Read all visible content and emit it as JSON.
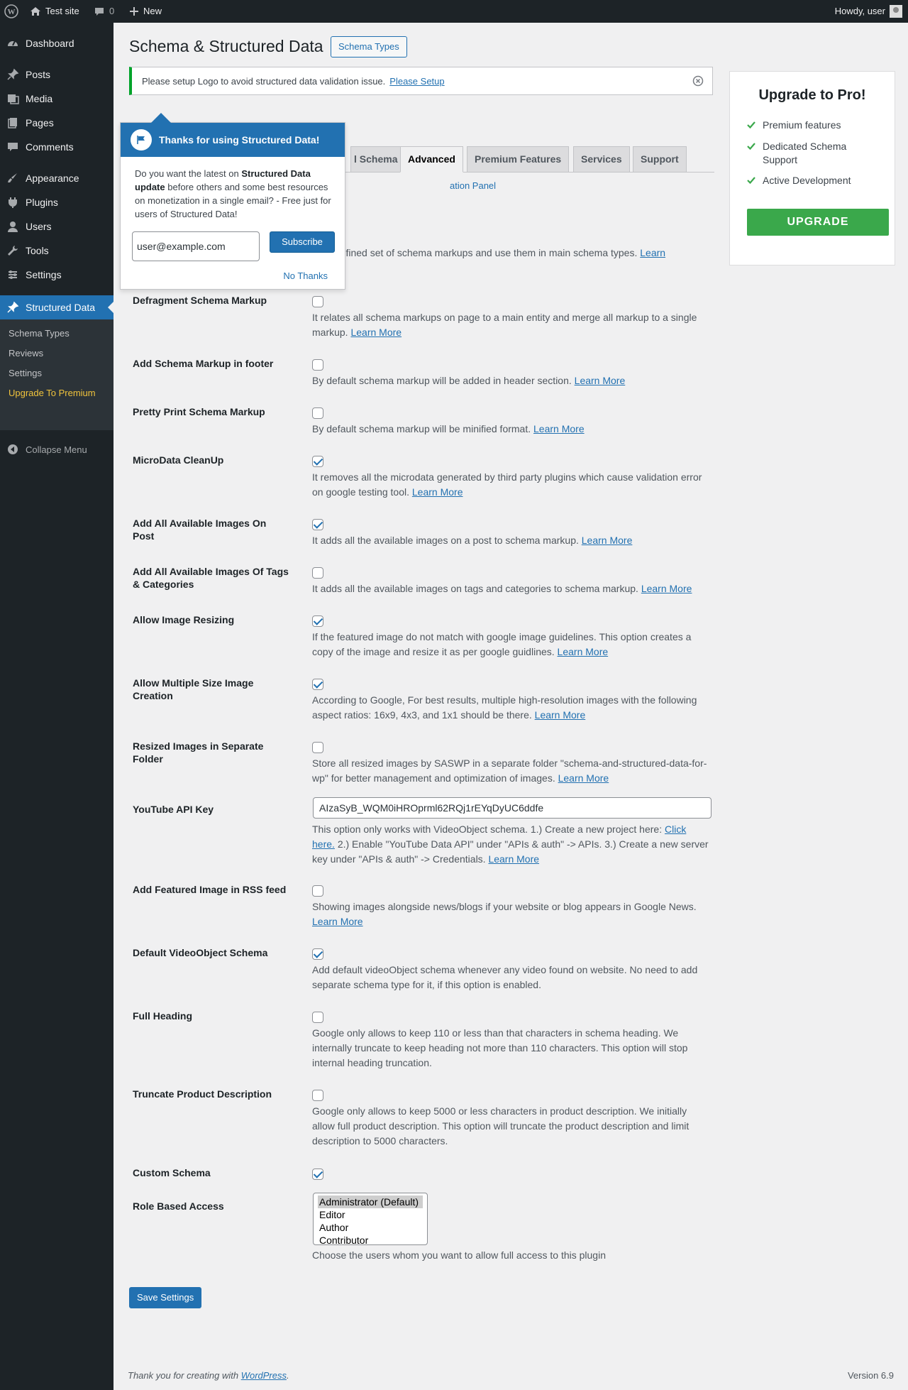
{
  "adminbar": {
    "site": "Test site",
    "comments_count": "0",
    "new": "New",
    "howdy": "Howdy, user"
  },
  "sidebar": {
    "items": [
      {
        "label": "Dashboard",
        "icon": "dashboard-icon"
      },
      {
        "label": "Posts",
        "icon": "pin-icon"
      },
      {
        "label": "Media",
        "icon": "media-icon"
      },
      {
        "label": "Pages",
        "icon": "pages-icon"
      },
      {
        "label": "Comments",
        "icon": "comment-icon"
      },
      {
        "label": "Appearance",
        "icon": "brush-icon"
      },
      {
        "label": "Plugins",
        "icon": "plugin-icon"
      },
      {
        "label": "Users",
        "icon": "user-icon"
      },
      {
        "label": "Tools",
        "icon": "wrench-icon"
      },
      {
        "label": "Settings",
        "icon": "settings-icon"
      },
      {
        "label": "Structured Data",
        "icon": "pin-icon"
      }
    ],
    "submenu": [
      "Schema Types",
      "Reviews",
      "Settings",
      "Upgrade To Premium"
    ],
    "collapse": "Collapse Menu"
  },
  "page": {
    "title": "Schema & Structured Data",
    "title_button": "Schema Types"
  },
  "notice": {
    "text": "Please setup Logo to avoid structured data validation issue.",
    "link": "Please Setup"
  },
  "tabs": [
    "l Schema",
    "Advanced",
    "Premium Features",
    "Services",
    "Support"
  ],
  "sub_link": "ation Panel",
  "partial_row_text": "a predefined set of schema markups and use them in main schema types.",
  "learn": "Learn",
  "learn_more": "Learn More",
  "rows": [
    {
      "label": "Defragment Schema Markup",
      "checked": false,
      "desc": "It relates all schema markups on page to a main entity and merge all markup to a single markup."
    },
    {
      "label": "Add Schema Markup in footer",
      "checked": false,
      "desc": "By default schema markup will be added in header section."
    },
    {
      "label": "Pretty Print Schema Markup",
      "checked": false,
      "desc": "By default schema markup will be minified format."
    },
    {
      "label": "MicroData CleanUp",
      "checked": true,
      "desc": "It removes all the microdata generated by third party plugins which cause validation error on google testing tool."
    },
    {
      "label": "Add All Available Images On Post",
      "checked": true,
      "desc": "It adds all the available images on a post to schema markup."
    },
    {
      "label": "Add All Available Images Of Tags & Categories",
      "checked": false,
      "desc": "It adds all the available images on tags and categories to schema markup."
    },
    {
      "label": "Allow Image Resizing",
      "checked": true,
      "desc": "If the featured image do not match with google image guidelines. This option creates a copy of the image and resize it as per google guidlines."
    },
    {
      "label": "Allow Multiple Size Image Creation",
      "checked": true,
      "desc": "According to Google, For best results, multiple high-resolution images with the following aspect ratios: 16x9, 4x3, and 1x1 should be there."
    },
    {
      "label": "Resized Images in Separate Folder",
      "checked": false,
      "desc": "Store all resized images by SASWP in a separate folder \"schema-and-structured-data-for-wp\" for better management and optimization of images."
    },
    {
      "label": "YouTube API Key",
      "value": "AIzaSyB_WQM0iHROprml62RQj1rEYqDyUC6ddfe",
      "desc_before": "This option only works with VideoObject schema. 1.) Create a new project here:",
      "click_here": "Click here.",
      "desc_after": "2.) Enable \"YouTube Data API\" under \"APIs & auth\" -> APIs. 3.) Create a new server key under \"APIs & auth\" -> Credentials."
    },
    {
      "label": "Add Featured Image in RSS feed",
      "checked": false,
      "desc": "Showing images alongside news/blogs if your website or blog appears in Google News."
    },
    {
      "label": "Default VideoObject Schema",
      "checked": true,
      "desc": "Add default videoObject schema whenever any video found on website. No need to add separate schema type for it, if this option is enabled."
    },
    {
      "label": "Full Heading",
      "checked": false,
      "desc": "Google only allows to keep 110 or less than that characters in schema heading. We internally truncate to keep heading not more than 110 characters. This option will stop internal heading truncation."
    },
    {
      "label": "Truncate Product Description",
      "checked": false,
      "desc": "Google only allows to keep 5000 or less characters in product description. We initially allow full product description. This option will truncate the product description and limit description to 5000 characters."
    },
    {
      "label": "Custom Schema",
      "checked": true
    },
    {
      "label": "Role Based Access",
      "options": [
        "Administrator (Default)",
        "Editor",
        "Author",
        "Contributor"
      ],
      "selected": "Administrator (Default)",
      "desc": "Choose the users whom you want to allow full access to this plugin"
    }
  ],
  "save": "Save Settings",
  "footer": {
    "thanks": "Thank you for creating with",
    "wp": "WordPress",
    "period": ".",
    "version": "Version 6.9"
  },
  "pro": {
    "title": "Upgrade to Pro!",
    "features": [
      "Premium features",
      "Dedicated Schema Support",
      "Active Development"
    ],
    "button": "UPGRADE"
  },
  "popup": {
    "title": "Thanks for using Structured Data!",
    "body_1": "Do you want the latest on",
    "body_bold": "Structured Data update",
    "body_2": "before others and some best resources on monetization in a single email? - Free just for users of Structured Data!",
    "email": "user@example.com",
    "subscribe": "Subscribe",
    "no_thanks": "No Thanks"
  },
  "colors": {
    "primary": "#2271b1",
    "sidebar": "#1d2327",
    "success": "#00a32a",
    "upgrade": "#3aa84b"
  }
}
